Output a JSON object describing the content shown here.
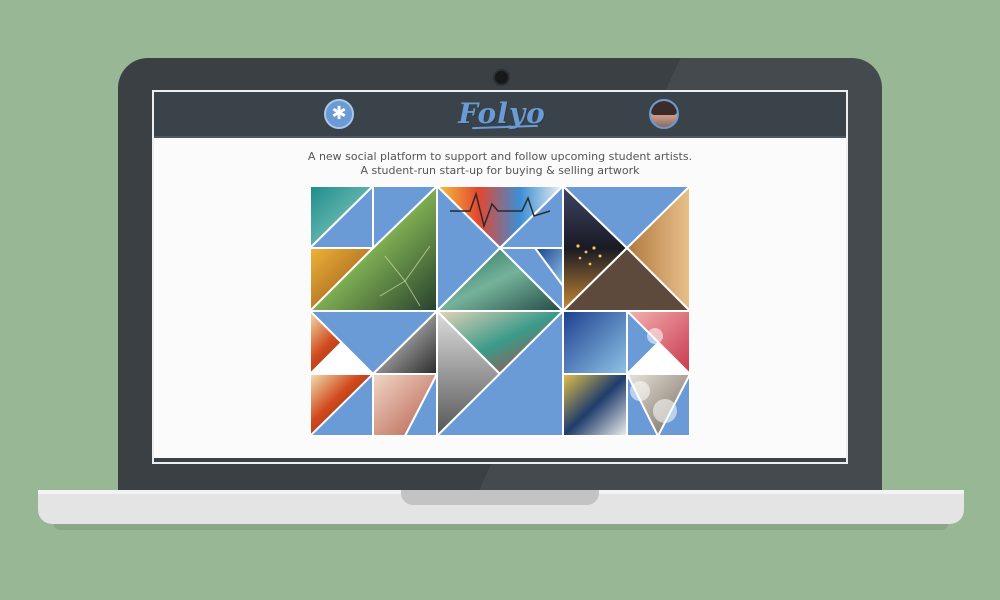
{
  "navbar": {
    "star_icon": "✱",
    "logo_text": "Folyo"
  },
  "tagline": {
    "line1": "A new social platform to support and follow upcoming student artists.",
    "line2": "A student-run start-up for buying & selling artwork"
  },
  "colors": {
    "background": "#98b795",
    "laptop_bezel": "#3b4044",
    "navbar": "#3a4349",
    "accent_blue": "#6a9bd6",
    "screen": "#fbfbfb"
  }
}
